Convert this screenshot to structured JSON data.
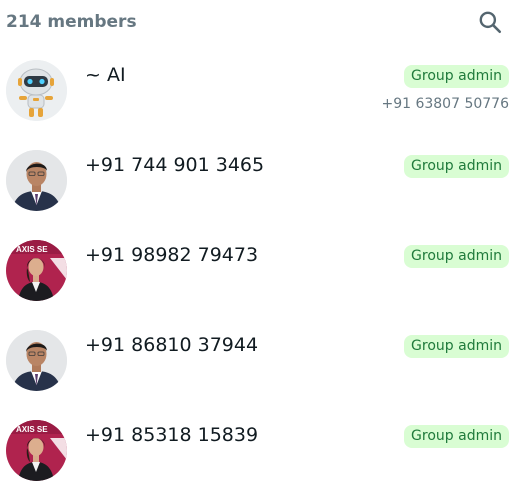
{
  "header": {
    "member_count": "214 members",
    "search_icon": "search-icon"
  },
  "colors": {
    "badge_bg": "#d9fdd3",
    "badge_text": "#1f7a3b",
    "secondary_text": "#667781",
    "primary_text": "#111b21"
  },
  "members": [
    {
      "name": "~ AI",
      "badge": "Group admin",
      "phone": "+91 63807 50776",
      "avatar": "robot-avatar"
    },
    {
      "name": "+91 744 901 3465",
      "badge": "Group admin",
      "avatar": "man-photo-avatar"
    },
    {
      "name": "+91 98982 79473",
      "badge": "Group admin",
      "avatar": "woman-photo-avatar"
    },
    {
      "name": "+91 86810 37944",
      "badge": "Group admin",
      "avatar": "man-photo-avatar"
    },
    {
      "name": "+91 85318 15839",
      "badge": "Group admin",
      "avatar": "woman-photo-avatar"
    }
  ]
}
